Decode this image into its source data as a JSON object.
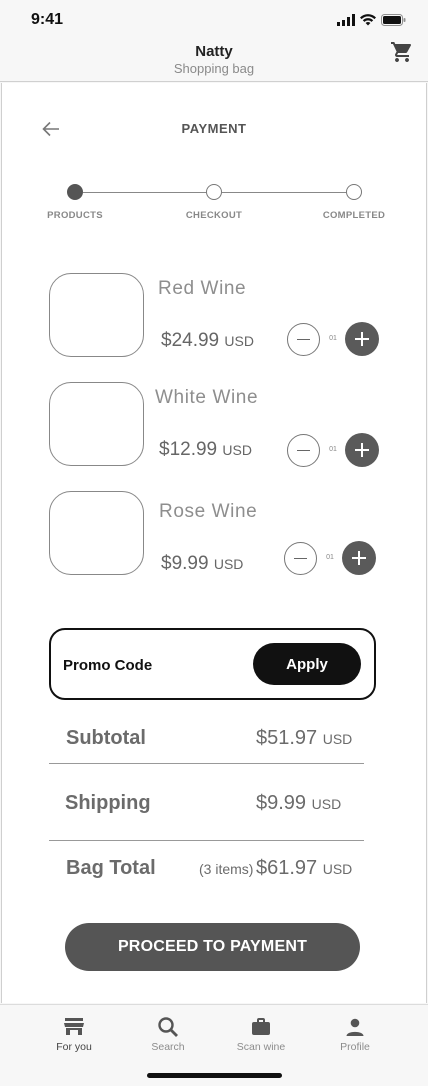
{
  "status_bar": {
    "time": "9:41"
  },
  "header": {
    "title": "Natty",
    "subtitle": "Shopping bag"
  },
  "page": {
    "title": "PAYMENT"
  },
  "progress": {
    "current_step": 1,
    "steps": [
      {
        "label": "PRODUCTS"
      },
      {
        "label": "CHECKOUT"
      },
      {
        "label": "COMPLETED"
      }
    ]
  },
  "products": [
    {
      "name": "Red Wine",
      "price": "$24.99",
      "currency": "USD",
      "quantity": "01"
    },
    {
      "name": "White Wine",
      "price": "$12.99",
      "currency": "USD",
      "quantity": "01"
    },
    {
      "name": "Rose Wine",
      "price": "$9.99",
      "currency": "USD",
      "quantity": "01"
    }
  ],
  "promo": {
    "label": "Promo Code",
    "apply_label": "Apply"
  },
  "summary": {
    "subtotal": {
      "label": "Subtotal",
      "value": "$51.97",
      "currency": "USD"
    },
    "shipping": {
      "label": "Shipping",
      "value": "$9.99",
      "currency": "USD"
    },
    "total": {
      "label": "Bag Total",
      "count": "(3 items)",
      "value": "$61.97",
      "currency": "USD"
    }
  },
  "proceed_label": "PROCEED TO PAYMENT",
  "tabs": [
    {
      "label": "For you",
      "icon": "store-icon",
      "active": true
    },
    {
      "label": "Search",
      "icon": "search-icon",
      "active": false
    },
    {
      "label": "Scan wine",
      "icon": "briefcase-icon",
      "active": false
    },
    {
      "label": "Profile",
      "icon": "person-icon",
      "active": false
    }
  ],
  "colors": {
    "accent_dark": "#111111",
    "button_gray": "#555555",
    "text_gray": "#6b6b6b"
  }
}
